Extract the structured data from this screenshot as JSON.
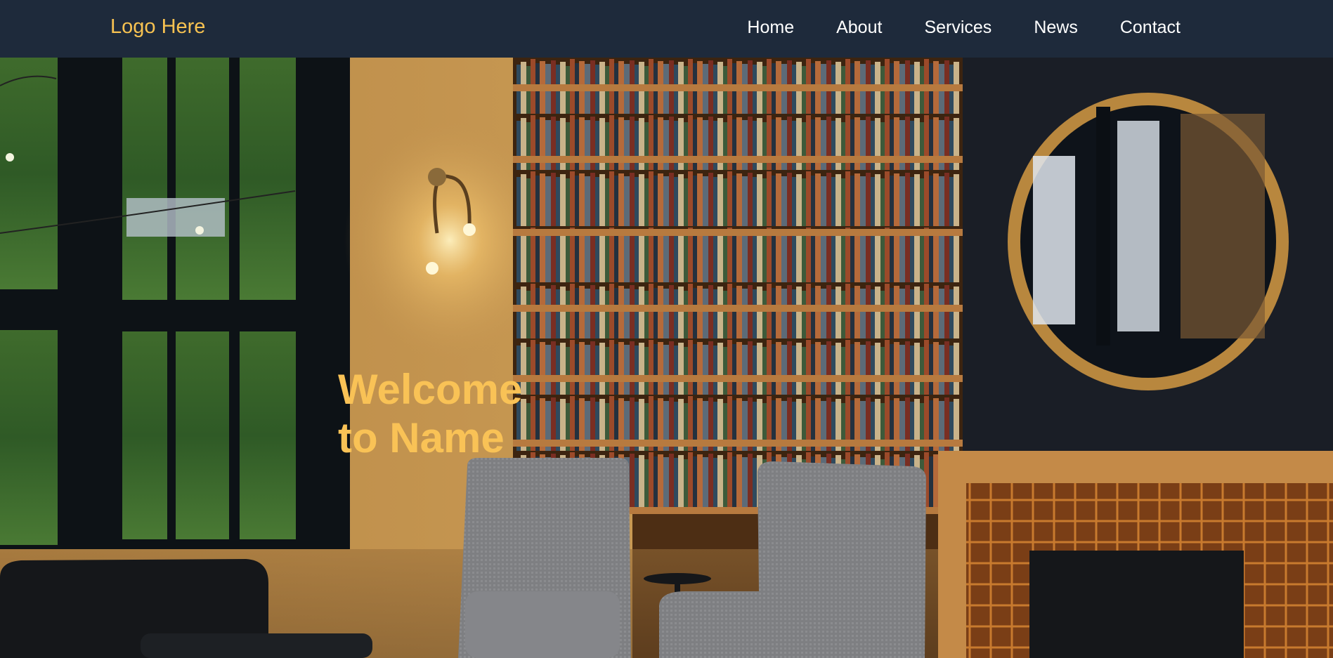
{
  "header": {
    "logo_text": "Logo Here",
    "nav": [
      {
        "label": "Home"
      },
      {
        "label": "About"
      },
      {
        "label": "Services"
      },
      {
        "label": "News"
      },
      {
        "label": "Contact"
      }
    ]
  },
  "hero": {
    "title": "Welcome to Name"
  },
  "colors": {
    "nav_background": "#1e2a3b",
    "accent": "#f7c251",
    "nav_text": "#ffffff"
  }
}
